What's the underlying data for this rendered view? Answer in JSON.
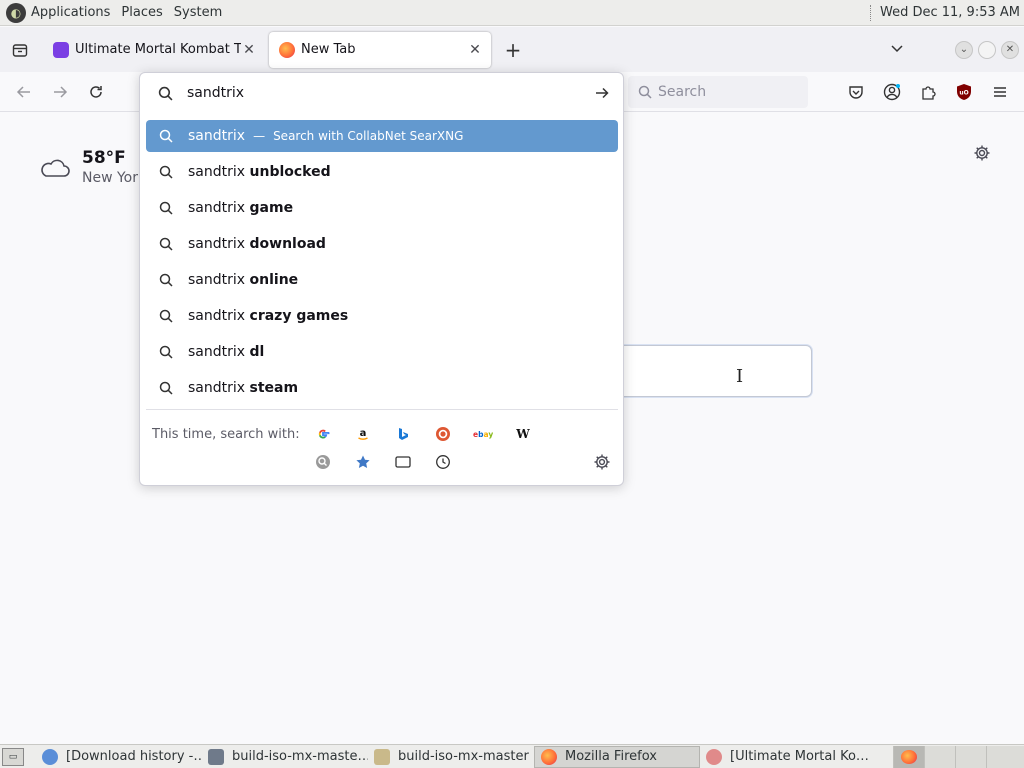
{
  "top_panel": {
    "menus": [
      "Applications",
      "Places",
      "System"
    ],
    "clock": "Wed Dec 11,  9:53 AM"
  },
  "tabs": [
    {
      "title": "Ultimate Mortal Kombat Tri",
      "favicon_color": "#7b3fe4",
      "active": false
    },
    {
      "title": "New Tab",
      "favicon_color": "#ff7139",
      "active": true
    }
  ],
  "navbar": {
    "search_placeholder": "Search"
  },
  "urlbar": {
    "value": "sandtrix",
    "results": [
      {
        "prefix": "sandtrix",
        "suffix": "",
        "action": "Search with CollabNet SearXNG",
        "selected": true
      },
      {
        "prefix": "sandtrix",
        "suffix": "unblocked"
      },
      {
        "prefix": "sandtrix",
        "suffix": "game"
      },
      {
        "prefix": "sandtrix",
        "suffix": "download"
      },
      {
        "prefix": "sandtrix",
        "suffix": "online"
      },
      {
        "prefix": "sandtrix",
        "suffix": "crazy games"
      },
      {
        "prefix": "sandtrix",
        "suffix": "dl"
      },
      {
        "prefix": "sandtrix",
        "suffix": "steam"
      }
    ],
    "oneoff_label": "This time, search with:",
    "engines": [
      "google-icon",
      "amazon-icon",
      "bing-icon",
      "duckduckgo-icon",
      "ebay-icon",
      "wikipedia-icon"
    ],
    "modes": [
      "searxng-icon",
      "bookmarks-star-icon",
      "tabs-icon",
      "history-clock-icon"
    ]
  },
  "weather": {
    "temp": "58°F",
    "location": "New York"
  },
  "taskbar": {
    "items": [
      {
        "label": "[Download history -…",
        "icon_color": "#5a8ed8"
      },
      {
        "label": "build-iso-mx-maste…",
        "icon_color": "#6f7a8a"
      },
      {
        "label": "build-iso-mx-master",
        "icon_color": "#c9b98a"
      },
      {
        "label": "Mozilla Firefox",
        "icon_color": "#ff7139",
        "active": true
      },
      {
        "label": "[Ultimate Mortal Ko…",
        "icon_color": "#e08a8a"
      }
    ]
  }
}
